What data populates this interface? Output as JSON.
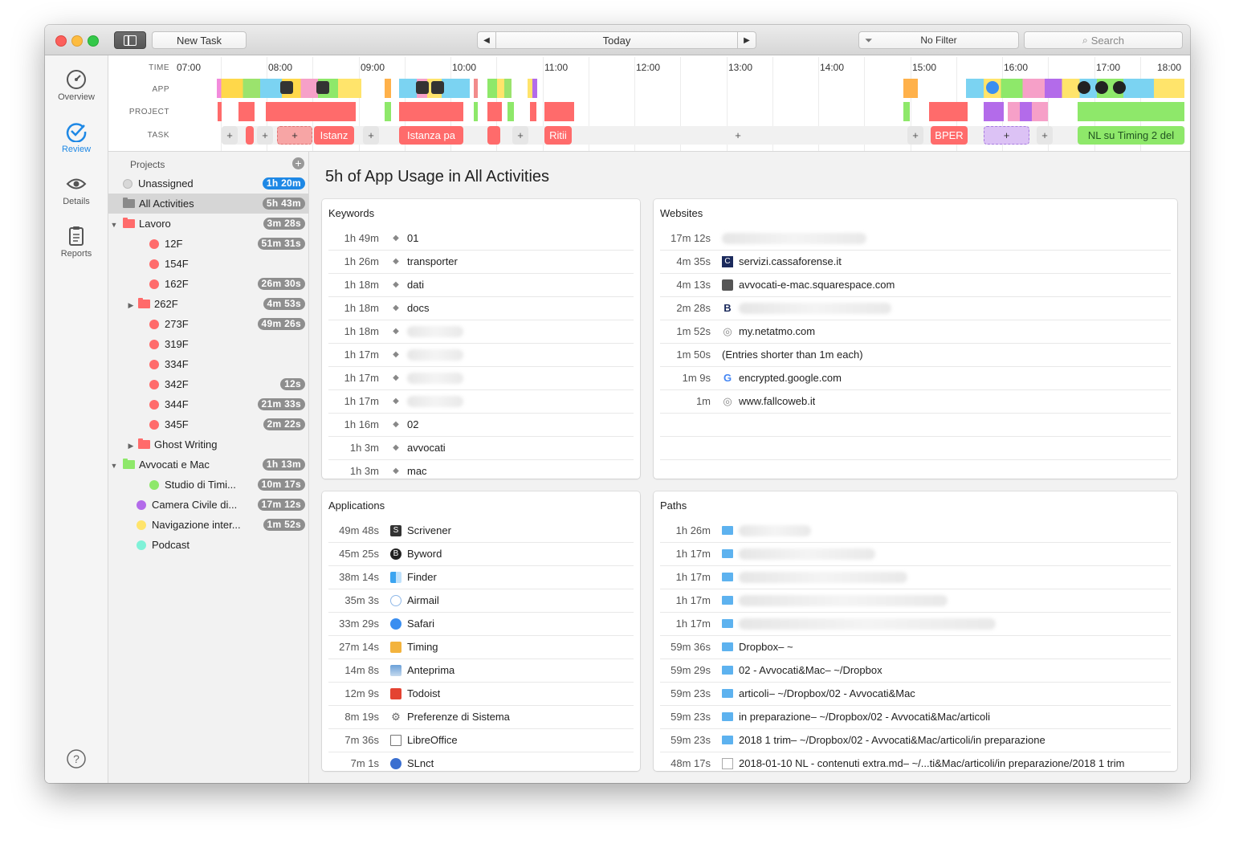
{
  "toolbar": {
    "new_task": "New Task",
    "date": "Today",
    "filter": "No Filter",
    "search_placeholder": "Search"
  },
  "nav": {
    "overview": "Overview",
    "review": "Review",
    "details": "Details",
    "reports": "Reports"
  },
  "timeline": {
    "labels": {
      "time": "TIME",
      "app": "APP",
      "project": "PROJECT",
      "task": "TASK"
    },
    "hours": [
      "07:00",
      "08:00",
      "09:00",
      "10:00",
      "11:00",
      "12:00",
      "13:00",
      "14:00",
      "15:00",
      "16:00",
      "17:00",
      "18:00"
    ],
    "tasks": {
      "t1": "+",
      "t2": "+",
      "t3": "+",
      "t4": "Istanz",
      "t5": "+",
      "t6": "Istanza pa",
      "t7": "+",
      "t8": "Ritii",
      "t9": "+",
      "t10": "+",
      "t11": "BPER",
      "t12": "+",
      "t13": "+",
      "t14": "NL su Timing 2 del"
    }
  },
  "projects": {
    "header": "Projects",
    "items": [
      {
        "label": "Unassigned",
        "time": "1h 20m"
      },
      {
        "label": "All Activities",
        "time": "5h 43m"
      },
      {
        "label": "Lavoro",
        "time": "3m 28s"
      },
      {
        "label": "12F",
        "time": "51m 31s"
      },
      {
        "label": "154F",
        "time": ""
      },
      {
        "label": "162F",
        "time": "26m 30s"
      },
      {
        "label": "262F",
        "time": "4m 53s"
      },
      {
        "label": "273F",
        "time": "49m 26s"
      },
      {
        "label": "319F",
        "time": ""
      },
      {
        "label": "334F",
        "time": ""
      },
      {
        "label": "342F",
        "time": "12s"
      },
      {
        "label": "344F",
        "time": "21m 33s"
      },
      {
        "label": "345F",
        "time": "2m 22s"
      },
      {
        "label": "Ghost Writing",
        "time": ""
      },
      {
        "label": "Avvocati e Mac",
        "time": "1h 13m"
      },
      {
        "label": "Studio di Timi...",
        "time": "10m 17s"
      },
      {
        "label": "Camera Civile di...",
        "time": "17m 12s"
      },
      {
        "label": "Navigazione inter...",
        "time": "1m 52s"
      },
      {
        "label": "Podcast",
        "time": ""
      }
    ]
  },
  "main": {
    "title": "5h of App Usage in All Activities",
    "keywords": {
      "title": "Keywords",
      "rows": [
        {
          "time": "1h 49m",
          "label": "01"
        },
        {
          "time": "1h 26m",
          "label": "transporter"
        },
        {
          "time": "1h 18m",
          "label": "dati"
        },
        {
          "time": "1h 18m",
          "label": "docs"
        },
        {
          "time": "1h 18m",
          "label": ""
        },
        {
          "time": "1h 17m",
          "label": ""
        },
        {
          "time": "1h 17m",
          "label": ""
        },
        {
          "time": "1h 17m",
          "label": ""
        },
        {
          "time": "1h 16m",
          "label": "02"
        },
        {
          "time": "1h 3m",
          "label": "avvocati"
        },
        {
          "time": "1h 3m",
          "label": "mac"
        }
      ]
    },
    "websites": {
      "title": "Websites",
      "rows": [
        {
          "time": "17m 12s",
          "label": ""
        },
        {
          "time": "4m 35s",
          "label": "servizi.cassaforense.it"
        },
        {
          "time": "4m 13s",
          "label": "avvocati-e-mac.squarespace.com"
        },
        {
          "time": "2m 28s",
          "label": ""
        },
        {
          "time": "1m 52s",
          "label": "my.netatmo.com"
        },
        {
          "time": "1m 50s",
          "label": "(Entries shorter than 1m each)"
        },
        {
          "time": "1m 9s",
          "label": "encrypted.google.com"
        },
        {
          "time": "1m",
          "label": "www.fallcoweb.it"
        }
      ]
    },
    "applications": {
      "title": "Applications",
      "rows": [
        {
          "time": "49m 48s",
          "label": "Scrivener"
        },
        {
          "time": "45m 25s",
          "label": "Byword"
        },
        {
          "time": "38m 14s",
          "label": "Finder"
        },
        {
          "time": "35m 3s",
          "label": "Airmail"
        },
        {
          "time": "33m 29s",
          "label": "Safari"
        },
        {
          "time": "27m 14s",
          "label": "Timing"
        },
        {
          "time": "14m 8s",
          "label": "Anteprima"
        },
        {
          "time": "12m 9s",
          "label": "Todoist"
        },
        {
          "time": "8m 19s",
          "label": "Preferenze di Sistema"
        },
        {
          "time": "7m 36s",
          "label": "LibreOffice"
        },
        {
          "time": "7m 1s",
          "label": "SLnct"
        }
      ]
    },
    "paths": {
      "title": "Paths",
      "rows": [
        {
          "time": "1h 26m",
          "label": "",
          "sub": ""
        },
        {
          "time": "1h 17m",
          "label": "",
          "sub": ""
        },
        {
          "time": "1h 17m",
          "label": "",
          "sub": ""
        },
        {
          "time": "1h 17m",
          "label": "",
          "sub": ""
        },
        {
          "time": "1h 17m",
          "label": "",
          "sub": ""
        },
        {
          "time": "59m 36s",
          "label": "Dropbox",
          "sub": " – ~"
        },
        {
          "time": "59m 29s",
          "label": "02 - Avvocati&Mac",
          "sub": " – ~/Dropbox"
        },
        {
          "time": "59m 23s",
          "label": "articoli",
          "sub": " – ~/Dropbox/02 - Avvocati&Mac"
        },
        {
          "time": "59m 23s",
          "label": "in preparazione",
          "sub": " – ~/Dropbox/02 - Avvocati&Mac/articoli"
        },
        {
          "time": "59m 23s",
          "label": "2018 1 trim",
          "sub": " – ~/Dropbox/02 - Avvocati&Mac/articoli/in preparazione"
        },
        {
          "time": "48m 17s",
          "label": "2018-01-10 NL - contenuti extra.md",
          "sub": " – ~/...ti&Mac/articoli/in preparazione/2018 1 trim"
        }
      ]
    }
  },
  "colors": {
    "accent": "#1e88e5",
    "project_red": "#ff6b6b",
    "project_green": "#8ee86a",
    "project_purple": "#b36bea",
    "project_yellow": "#ffe46b",
    "project_teal": "#7ff2d8"
  }
}
